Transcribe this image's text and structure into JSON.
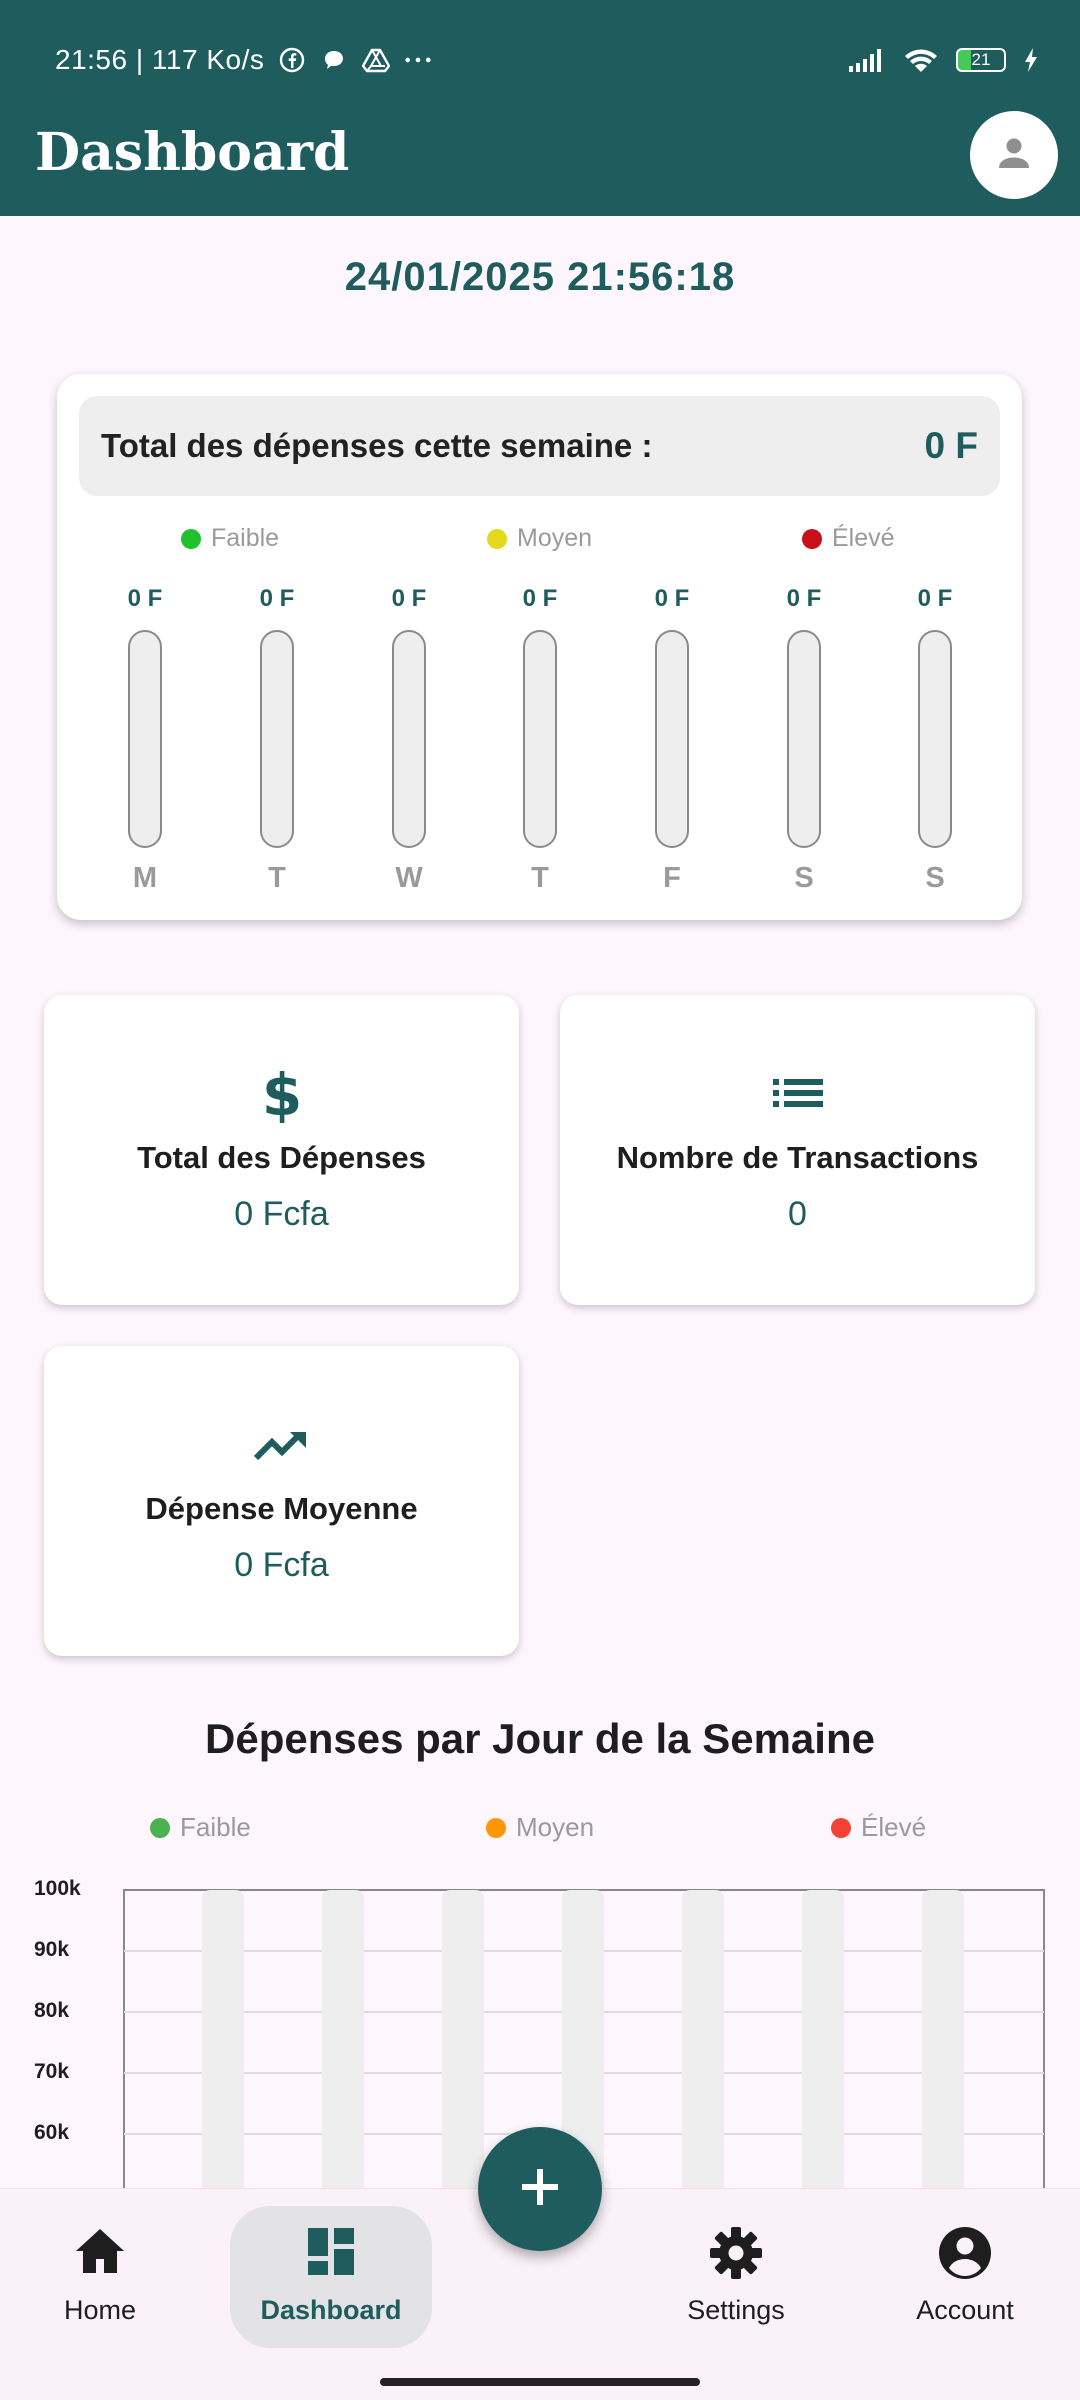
{
  "status_bar": {
    "time": "21:56 | 117 Ko/s",
    "battery": "21",
    "icons": [
      "facebook-icon",
      "chat-bubble-icon",
      "drive-icon",
      "more-dots-icon",
      "signal-icon",
      "wifi-icon",
      "battery-icon",
      "charging-icon"
    ]
  },
  "app_bar": {
    "title": "Dashboard",
    "profile_icon": "person-icon"
  },
  "datetime": "24/01/2025 21:56:18",
  "week_card": {
    "total_label": "Total des dépenses cette semaine :",
    "total_value": "0 F",
    "legend": [
      {
        "label": "Faible",
        "color": "#1fc12d"
      },
      {
        "label": "Moyen",
        "color": "#e3d81c"
      },
      {
        "label": "Élevé",
        "color": "#c8101a"
      }
    ],
    "days": [
      {
        "day": "M",
        "amount": "0 F",
        "level": 0
      },
      {
        "day": "T",
        "amount": "0 F",
        "level": 0
      },
      {
        "day": "W",
        "amount": "0 F",
        "level": 0
      },
      {
        "day": "T",
        "amount": "0 F",
        "level": 0
      },
      {
        "day": "F",
        "amount": "0 F",
        "level": 0
      },
      {
        "day": "S",
        "amount": "0 F",
        "level": 0
      },
      {
        "day": "S",
        "amount": "0 F",
        "level": 0
      }
    ]
  },
  "stats": {
    "total": {
      "icon": "dollar-icon",
      "title": "Total des Dépenses",
      "value": "0 Fcfa"
    },
    "count": {
      "icon": "list-icon",
      "title": "Nombre de Transactions",
      "value": "0"
    },
    "average": {
      "icon": "trending-up-icon",
      "title": "Dépense Moyenne",
      "value": "0 Fcfa"
    }
  },
  "chart_section": {
    "title": "Dépenses par Jour de la Semaine",
    "legend": [
      {
        "label": "Faible",
        "color": "#4caf50"
      },
      {
        "label": "Moyen",
        "color": "#ff9800"
      },
      {
        "label": "Élevé",
        "color": "#f44336"
      }
    ]
  },
  "chart_data": {
    "type": "bar",
    "title": "Dépenses par Jour de la Semaine",
    "categories": [
      "",
      "",
      "",
      "",
      "",
      "",
      ""
    ],
    "values": [
      0,
      0,
      0,
      0,
      0,
      0,
      0
    ],
    "ylim": [
      50000,
      100000
    ],
    "yticks": [
      "100k",
      "90k",
      "80k",
      "70k",
      "60k"
    ],
    "grid": true,
    "legend_position": "top"
  },
  "bottom_nav": {
    "items": [
      {
        "label": "Home",
        "icon": "home-icon"
      },
      {
        "label": "Dashboard",
        "icon": "dashboard-icon"
      },
      {
        "label": "Settings",
        "icon": "settings-gear-icon"
      },
      {
        "label": "Account",
        "icon": "account-circle-icon"
      }
    ],
    "fab_icon": "plus-icon"
  }
}
